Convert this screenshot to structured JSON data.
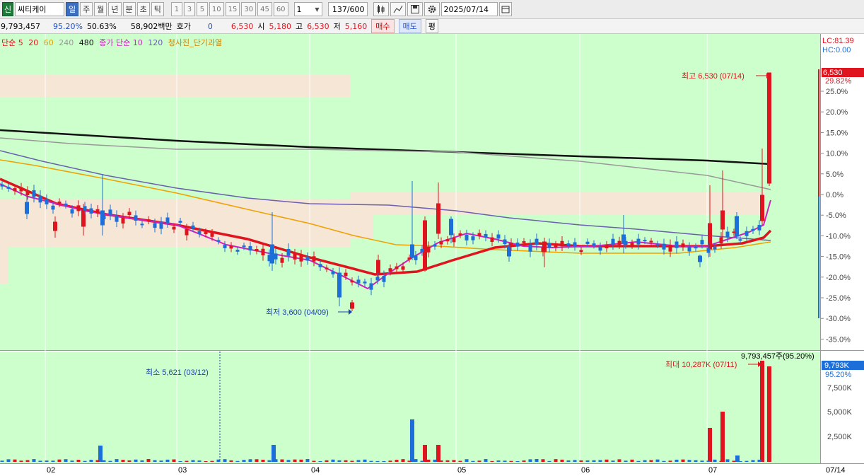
{
  "toolbar": {
    "badge": "신",
    "stock_name": "씨티케이",
    "periods": [
      "일",
      "주",
      "월",
      "년",
      "분",
      "초",
      "틱"
    ],
    "active_period": "일",
    "minute_options": [
      "1",
      "3",
      "5",
      "10",
      "15",
      "30",
      "45",
      "60"
    ],
    "interval_value": "1",
    "count": "137",
    "count_max": "/600",
    "date": "2025/07/14"
  },
  "info": {
    "volume": "9,793,457",
    "volume_ratio": "95.20%",
    "turnover": "50.63%",
    "amount": "58,902백만",
    "quote_label": "호가",
    "quote_value": "0",
    "price": "6,530",
    "open_label": "시",
    "open": "5,180",
    "high_label": "고",
    "high": "6,530",
    "low_label": "저",
    "low": "5,160",
    "buy_label": "매수",
    "sell_label": "매도",
    "flat_label": "평"
  },
  "legend": {
    "ma_label": "단순 5",
    "ma20": "20",
    "ma60": "60",
    "ma240": "240",
    "ma480": "480",
    "close_ma_label": "종가 단순 10",
    "close_ma120": "120",
    "cloud_label": "청사진_단기과열"
  },
  "right_axis": {
    "lc": "LC:81.39",
    "hc": "HC:0.00",
    "current_price": "6,530",
    "current_pct": "29.82%",
    "pct_ticks": [
      "25.0%",
      "20.0%",
      "15.0%",
      "10.0%",
      "5.0%",
      "0.0%",
      "-5.0%",
      "-10.0%",
      "-15.0%",
      "-20.0%",
      "-25.0%",
      "-30.0%",
      "-35.0%"
    ],
    "vol_current": "9,793K",
    "vol_current_pct": "95.20%",
    "vol_ticks": [
      "7,500K",
      "5,000K",
      "2,500K"
    ]
  },
  "annotations": {
    "high": "최고 6,530 (07/14)",
    "low": "최저 3,600 (04/09)",
    "vol_max": "최대 10,287K (07/11)",
    "vol_min": "최소 5,621 (03/12)",
    "vol_header": "9,793,457주(95.20%)"
  },
  "x_axis": {
    "months": [
      "02",
      "03",
      "04",
      "05",
      "06",
      "07"
    ],
    "last_date": "07/14"
  },
  "colors": {
    "up": "#e0141e",
    "down": "#1c6fd8",
    "chart_bg": "#ccffcc",
    "cloud": "#f5e6d6"
  },
  "chart_data": {
    "type": "candlestick",
    "x_range": [
      "2025-01-21",
      "2025-07-14"
    ],
    "y_range_price": [
      3250,
      6700
    ],
    "y_range_volume": [
      0,
      10287000
    ],
    "key_points": [
      {
        "date": "04/09",
        "low": 3600
      },
      {
        "date": "07/14",
        "high": 6530,
        "open": 5180,
        "low": 5160,
        "close": 6530
      }
    ],
    "moving_averages": [
      "5",
      "20",
      "60",
      "240",
      "480",
      "종가 단순 10",
      "120"
    ],
    "volume_peaks": [
      {
        "date": "07/11",
        "volume": 10287000
      },
      {
        "date": "03/12",
        "volume": 5621
      }
    ]
  }
}
